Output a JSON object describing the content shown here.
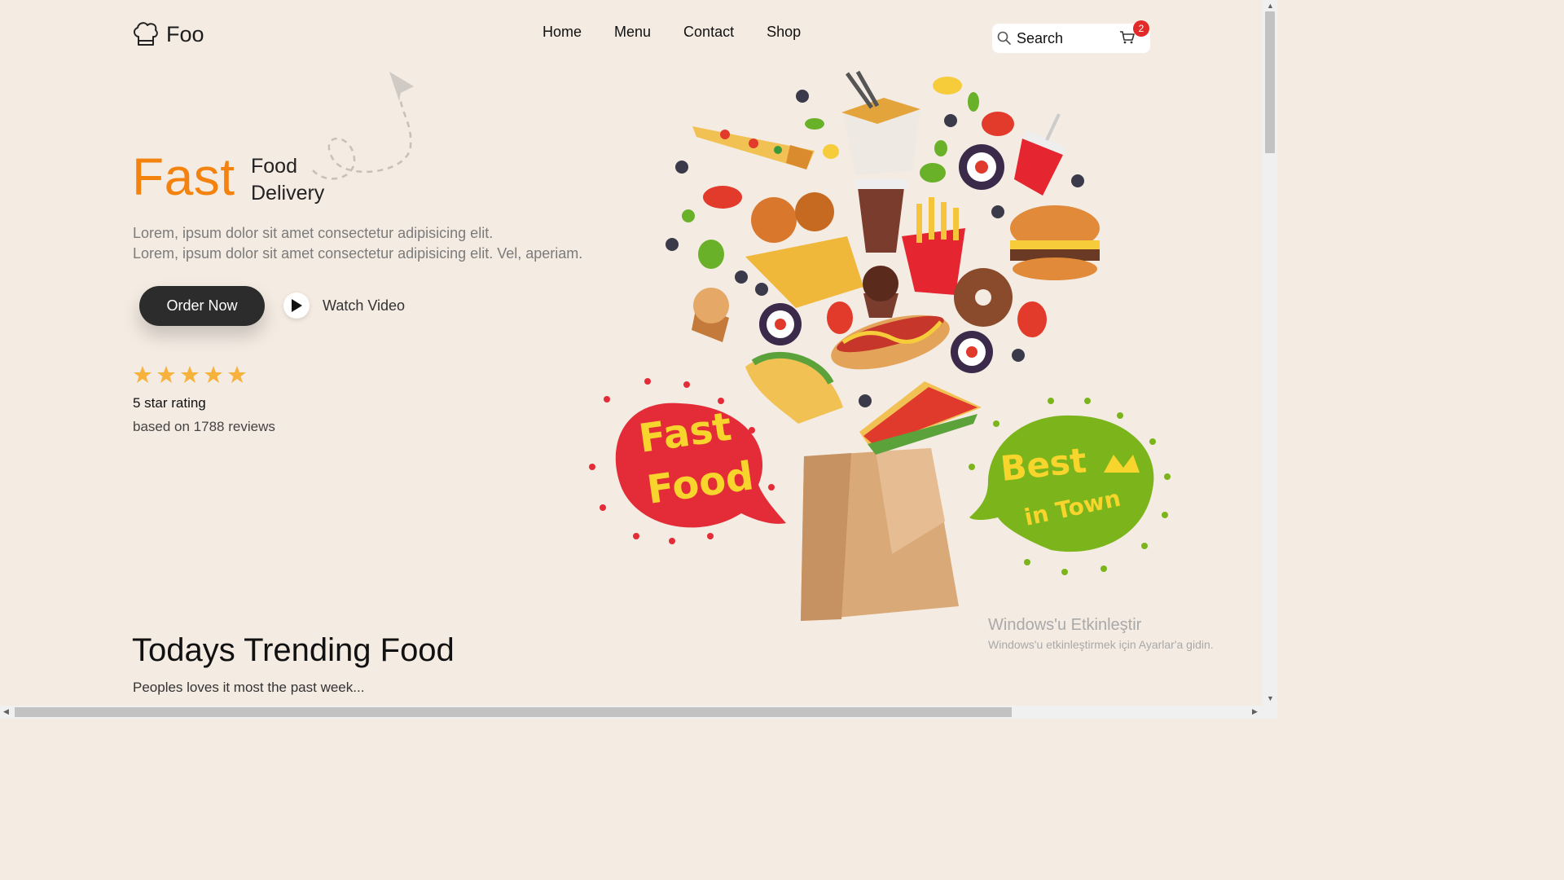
{
  "brand": {
    "name": "Foo",
    "logo_icon": "chef-hat-icon"
  },
  "nav": {
    "items": [
      "Home",
      "Menu",
      "Contact",
      "Shop"
    ]
  },
  "search": {
    "placeholder": "Search",
    "icon": "search-icon"
  },
  "cart": {
    "icon": "cart-icon",
    "count": "2",
    "badge_color": "#e32a2a"
  },
  "hero": {
    "title_big": "Fast",
    "title_small_line1": "Food",
    "title_small_line2": "Delivery",
    "desc_line1": "Lorem, ipsum dolor sit amet consectetur adipisicing elit.",
    "desc_line2": "Lorem, ipsum dolor sit amet consectetur adipisicing elit. Vel, aperiam.",
    "order_button": "Order Now",
    "watch_video": "Watch Video",
    "accent_color": "#f4820f"
  },
  "rating": {
    "stars": 5,
    "title": "5 star rating",
    "subtitle": "based on 1788 reviews",
    "star_color": "#f6b23c"
  },
  "trending": {
    "title": "Todays Trending Food",
    "subtitle": "Peoples loves it most the past week..."
  },
  "illustration": {
    "bubble_left_text_line1": "Fast",
    "bubble_left_text_line2": "Food",
    "bubble_right_text_line1": "Best",
    "bubble_right_text_line2": "in Town"
  },
  "watermark": {
    "line1": "Windows'u Etkinleştir",
    "line2": "Windows'u etkinleştirmek için Ayarlar'a gidin."
  }
}
